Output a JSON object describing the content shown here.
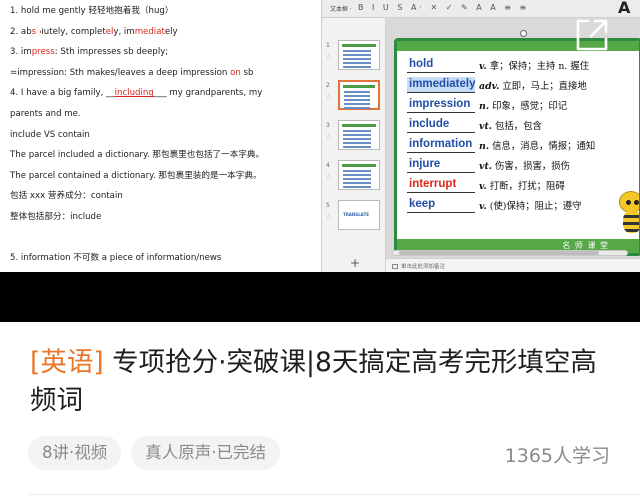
{
  "document": {
    "lines": [
      {
        "parts": [
          {
            "t": "1.  hold me gently  轻轻地抱着我（hug）"
          }
        ]
      },
      {
        "parts": [
          {
            "t": "2.  ab"
          },
          {
            "t": "so",
            "c": "r"
          },
          {
            "t": "lutely, complet"
          },
          {
            "t": "el",
            "c": "r"
          },
          {
            "t": "y, im"
          },
          {
            "t": "mediat",
            "c": "r"
          },
          {
            "t": "ely"
          }
        ]
      },
      {
        "parts": [
          {
            "t": "3.  im"
          },
          {
            "t": "press",
            "c": "r"
          },
          {
            "t": ": Sth impresses sb deeply;"
          }
        ]
      },
      {
        "parts": [
          {
            "t": "=impression: Sth makes/leaves a deep impression "
          },
          {
            "t": "on",
            "c": "r"
          },
          {
            "t": " sb"
          }
        ]
      },
      {
        "parts": [
          {
            "t": "4.  I   have   a   big   family,   __"
          },
          {
            "t": "including",
            "c": "r u"
          },
          {
            "t": "___   my   grandparents,   my"
          }
        ]
      },
      {
        "parts": [
          {
            "t": "parents and me."
          }
        ]
      },
      {
        "parts": [
          {
            "t": "include VS contain"
          }
        ]
      },
      {
        "parts": [
          {
            "t": "The parcel included a dictionary.  那包裹里也包括了一本字典。"
          }
        ]
      },
      {
        "parts": [
          {
            "t": "The parcel contained a dictionary.  那包裹里装的是一本字典。"
          }
        ]
      },
      {
        "parts": [
          {
            "t": "包括 xxx 营养成分：contain"
          }
        ]
      },
      {
        "parts": [
          {
            "t": "整体包括部分：include"
          }
        ]
      },
      {
        "parts": [
          {
            "t": ""
          }
        ]
      },
      {
        "parts": [
          {
            "t": "5.  information  不可数  a piece of information/news"
          }
        ]
      }
    ]
  },
  "ppt": {
    "toolbar_label": "文本框 ·",
    "toolbar_icons": "B I U S A· ✕ ✓ ✎ A A ≡ ≡",
    "toolbar_letter": "A",
    "thumbnails": [
      {
        "num": "1",
        "text": ""
      },
      {
        "num": "2",
        "text": ""
      },
      {
        "num": "3",
        "text": ""
      },
      {
        "num": "4",
        "text": ""
      },
      {
        "num": "5",
        "text": "TRANSLATE"
      }
    ],
    "add_slide": "+",
    "notes_placeholder": "单击此处添加备注",
    "teacher_label": "名 师 课 堂",
    "vocab": [
      {
        "word": "hold",
        "pos": "v.",
        "def": " 拿；保持；主持 n. 握住"
      },
      {
        "word": "immediately",
        "pos": "adv.",
        "def": " 立即，马上；直接地"
      },
      {
        "word": "impression",
        "pos": "n.",
        "def": " 印象，感觉；印记"
      },
      {
        "word": "include",
        "pos": "vt.",
        "def": " 包括，包含"
      },
      {
        "word": "information",
        "pos": "n.",
        "def": " 信息，消息，情报；通知"
      },
      {
        "word": "injure",
        "pos": "vt.",
        "def": " 伤害，损害，损伤"
      },
      {
        "word": "interrupt",
        "pos": "v.",
        "def": " 打断，打扰；阻碍"
      },
      {
        "word": "keep",
        "pos": "v.",
        "def": " (使)保持；阻止；遵守"
      }
    ]
  },
  "course": {
    "tag": "[英语]",
    "title": " 专项抢分·突破课|8天搞定高考完形填空高频词",
    "chip_lessons": "8讲·视频",
    "chip_voice": "真人原声·已完结",
    "learners": "1365人学习"
  },
  "colors": {
    "accent_orange": "#e8772a",
    "slide_green": "#56a847",
    "word_blue": "#1f4fa8",
    "doc_red": "#d9271b"
  },
  "icons": {
    "back": "chevron-left-icon",
    "fullscreen": "fullscreen-icon"
  }
}
